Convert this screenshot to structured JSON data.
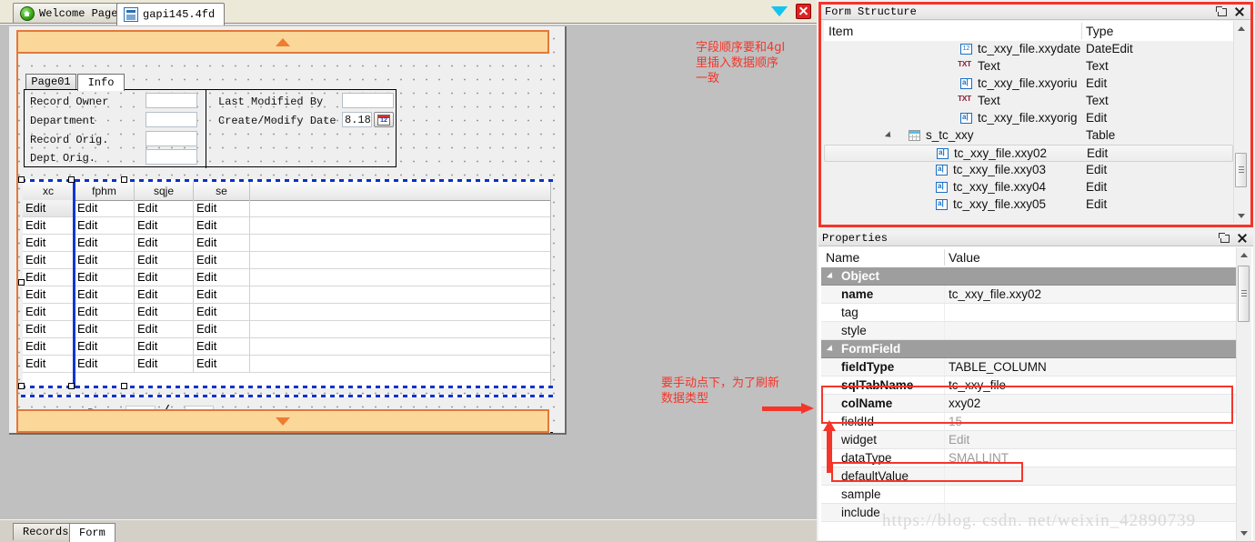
{
  "editor": {
    "tabs": [
      {
        "label": "Welcome Page",
        "icon": "home-icon",
        "active": false
      },
      {
        "label": "gapi145.4fd",
        "icon": "document-icon",
        "active": true
      }
    ],
    "window_controls": {
      "dropdown": "triangle-down-icon",
      "close": "close-icon"
    },
    "bottom_tabs": [
      {
        "label": "Records",
        "active": false
      },
      {
        "label": "Form",
        "active": true
      }
    ]
  },
  "designer": {
    "band_top": "collapse-up-chevron",
    "band_bottom": "collapse-down-chevron",
    "page_tabs": [
      {
        "label": "Page01",
        "active": false
      },
      {
        "label": "Info",
        "active": true
      }
    ],
    "info_fields": [
      {
        "label": "Record Owner"
      },
      {
        "label": "Department"
      },
      {
        "label": "Record Orig."
      },
      {
        "label": "Dept Orig."
      }
    ],
    "info_fields_right": [
      {
        "label": "Last Modified By",
        "value": ""
      },
      {
        "label": "Create/Modify Date",
        "value": "8.18"
      }
    ],
    "grid": {
      "headers": [
        "xc",
        "fphm",
        "sqje",
        "se"
      ],
      "cell_label": "Edit",
      "row_count": 10
    },
    "footer": {
      "rows_label": "Rows",
      "separator": "/",
      "field1": "",
      "field2": ""
    }
  },
  "annotations": {
    "top": "字段顺序要和4gl\n里插入数据顺序\n一致",
    "middle": "要手动点下，为了刷新\n数据类型",
    "color": "#f5352a"
  },
  "form_structure": {
    "title": "Form Structure",
    "columns": [
      "Item",
      "Type"
    ],
    "rows": [
      {
        "label": "tc_xxy_file.xxydate",
        "type": "DateEdit",
        "icon": "date-edit-icon",
        "indent": 150,
        "selected": false
      },
      {
        "label": "Text",
        "type": "Text",
        "icon": "text-icon",
        "indent": 150,
        "selected": false
      },
      {
        "label": "tc_xxy_file.xxyoriu",
        "type": "Edit",
        "icon": "edit-icon",
        "indent": 150,
        "selected": false
      },
      {
        "label": "Text",
        "type": "Text",
        "icon": "text-icon",
        "indent": 150,
        "selected": false
      },
      {
        "label": "tc_xxy_file.xxyorig",
        "type": "Edit",
        "icon": "edit-icon",
        "indent": 150,
        "selected": false
      },
      {
        "label": "s_tc_xxy",
        "type": "Table",
        "icon": "table-icon",
        "indent": 93,
        "selected": false,
        "expander": true
      },
      {
        "label": "tc_xxy_file.xxy02",
        "type": "Edit",
        "icon": "edit-icon",
        "indent": 123,
        "selected": true
      },
      {
        "label": "tc_xxy_file.xxy03",
        "type": "Edit",
        "icon": "edit-icon",
        "indent": 123,
        "selected": false
      },
      {
        "label": "tc_xxy_file.xxy04",
        "type": "Edit",
        "icon": "edit-icon",
        "indent": 123,
        "selected": false
      },
      {
        "label": "tc_xxy_file.xxy05",
        "type": "Edit",
        "icon": "edit-icon",
        "indent": 123,
        "selected": false
      }
    ]
  },
  "properties": {
    "title": "Properties",
    "columns": [
      "Name",
      "Value"
    ],
    "rows": [
      {
        "name": "Object",
        "value": "",
        "group": true
      },
      {
        "name": "name",
        "value": "tc_xxy_file.xxy02",
        "bold": true,
        "gray": false
      },
      {
        "name": "tag",
        "value": "",
        "bold": false,
        "gray": false
      },
      {
        "name": "style",
        "value": "",
        "bold": false,
        "gray": false
      },
      {
        "name": "FormField",
        "value": "",
        "group": true
      },
      {
        "name": "fieldType",
        "value": "TABLE_COLUMN",
        "bold": true,
        "gray": false
      },
      {
        "name": "sqlTabName",
        "value": "tc_xxy_file",
        "bold": true,
        "gray": false,
        "highlight": true
      },
      {
        "name": "colName",
        "value": "xxy02",
        "bold": true,
        "gray": false,
        "highlight": true
      },
      {
        "name": "fieldId",
        "value": "15",
        "bold": false,
        "gray": true
      },
      {
        "name": "widget",
        "value": "Edit",
        "bold": false,
        "gray": true
      },
      {
        "name": "dataType",
        "value": "SMALLINT",
        "bold": false,
        "gray": true,
        "highlight2": true
      },
      {
        "name": "defaultValue",
        "value": "",
        "bold": false,
        "gray": false
      },
      {
        "name": "sample",
        "value": "",
        "bold": false,
        "gray": false
      },
      {
        "name": "include",
        "value": "",
        "bold": false,
        "gray": false
      }
    ]
  },
  "watermark": "https://blog. csdn. net/weixin_42890739"
}
